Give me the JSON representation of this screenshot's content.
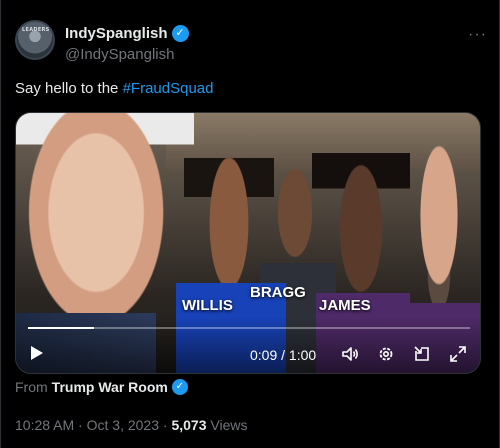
{
  "author": {
    "display_name": "IndySpanglish",
    "handle": "@IndySpanglish",
    "avatar_caption": "LEADERS",
    "verified_glyph": "✓"
  },
  "more_glyph": "···",
  "tweet": {
    "text_prefix": "Say hello to the ",
    "hashtag": "#FraudSquad"
  },
  "media": {
    "labels": {
      "willis": "WILLIS",
      "bragg": "BRAGG",
      "james": "JAMES"
    },
    "video": {
      "elapsed": "0:09",
      "duration": "1:00",
      "time_display": "0:09 / 1:00",
      "progress_fraction": 0.15
    }
  },
  "source": {
    "from_label": "From",
    "from_name": "Trump War Room"
  },
  "meta": {
    "time": "10:28 AM",
    "sep1": " · ",
    "date": "Oct 3, 2023",
    "sep2": " · ",
    "views_count": "5,073",
    "views_label": " Views"
  },
  "colors": {
    "accent": "#1d9bf0",
    "text": "#e7e9ea",
    "muted": "#71767b",
    "background": "#000000"
  },
  "icons": [
    "more-icon",
    "verified-icon",
    "play-icon",
    "volume-icon",
    "settings-icon",
    "picture-in-picture-icon",
    "fullscreen-icon"
  ]
}
